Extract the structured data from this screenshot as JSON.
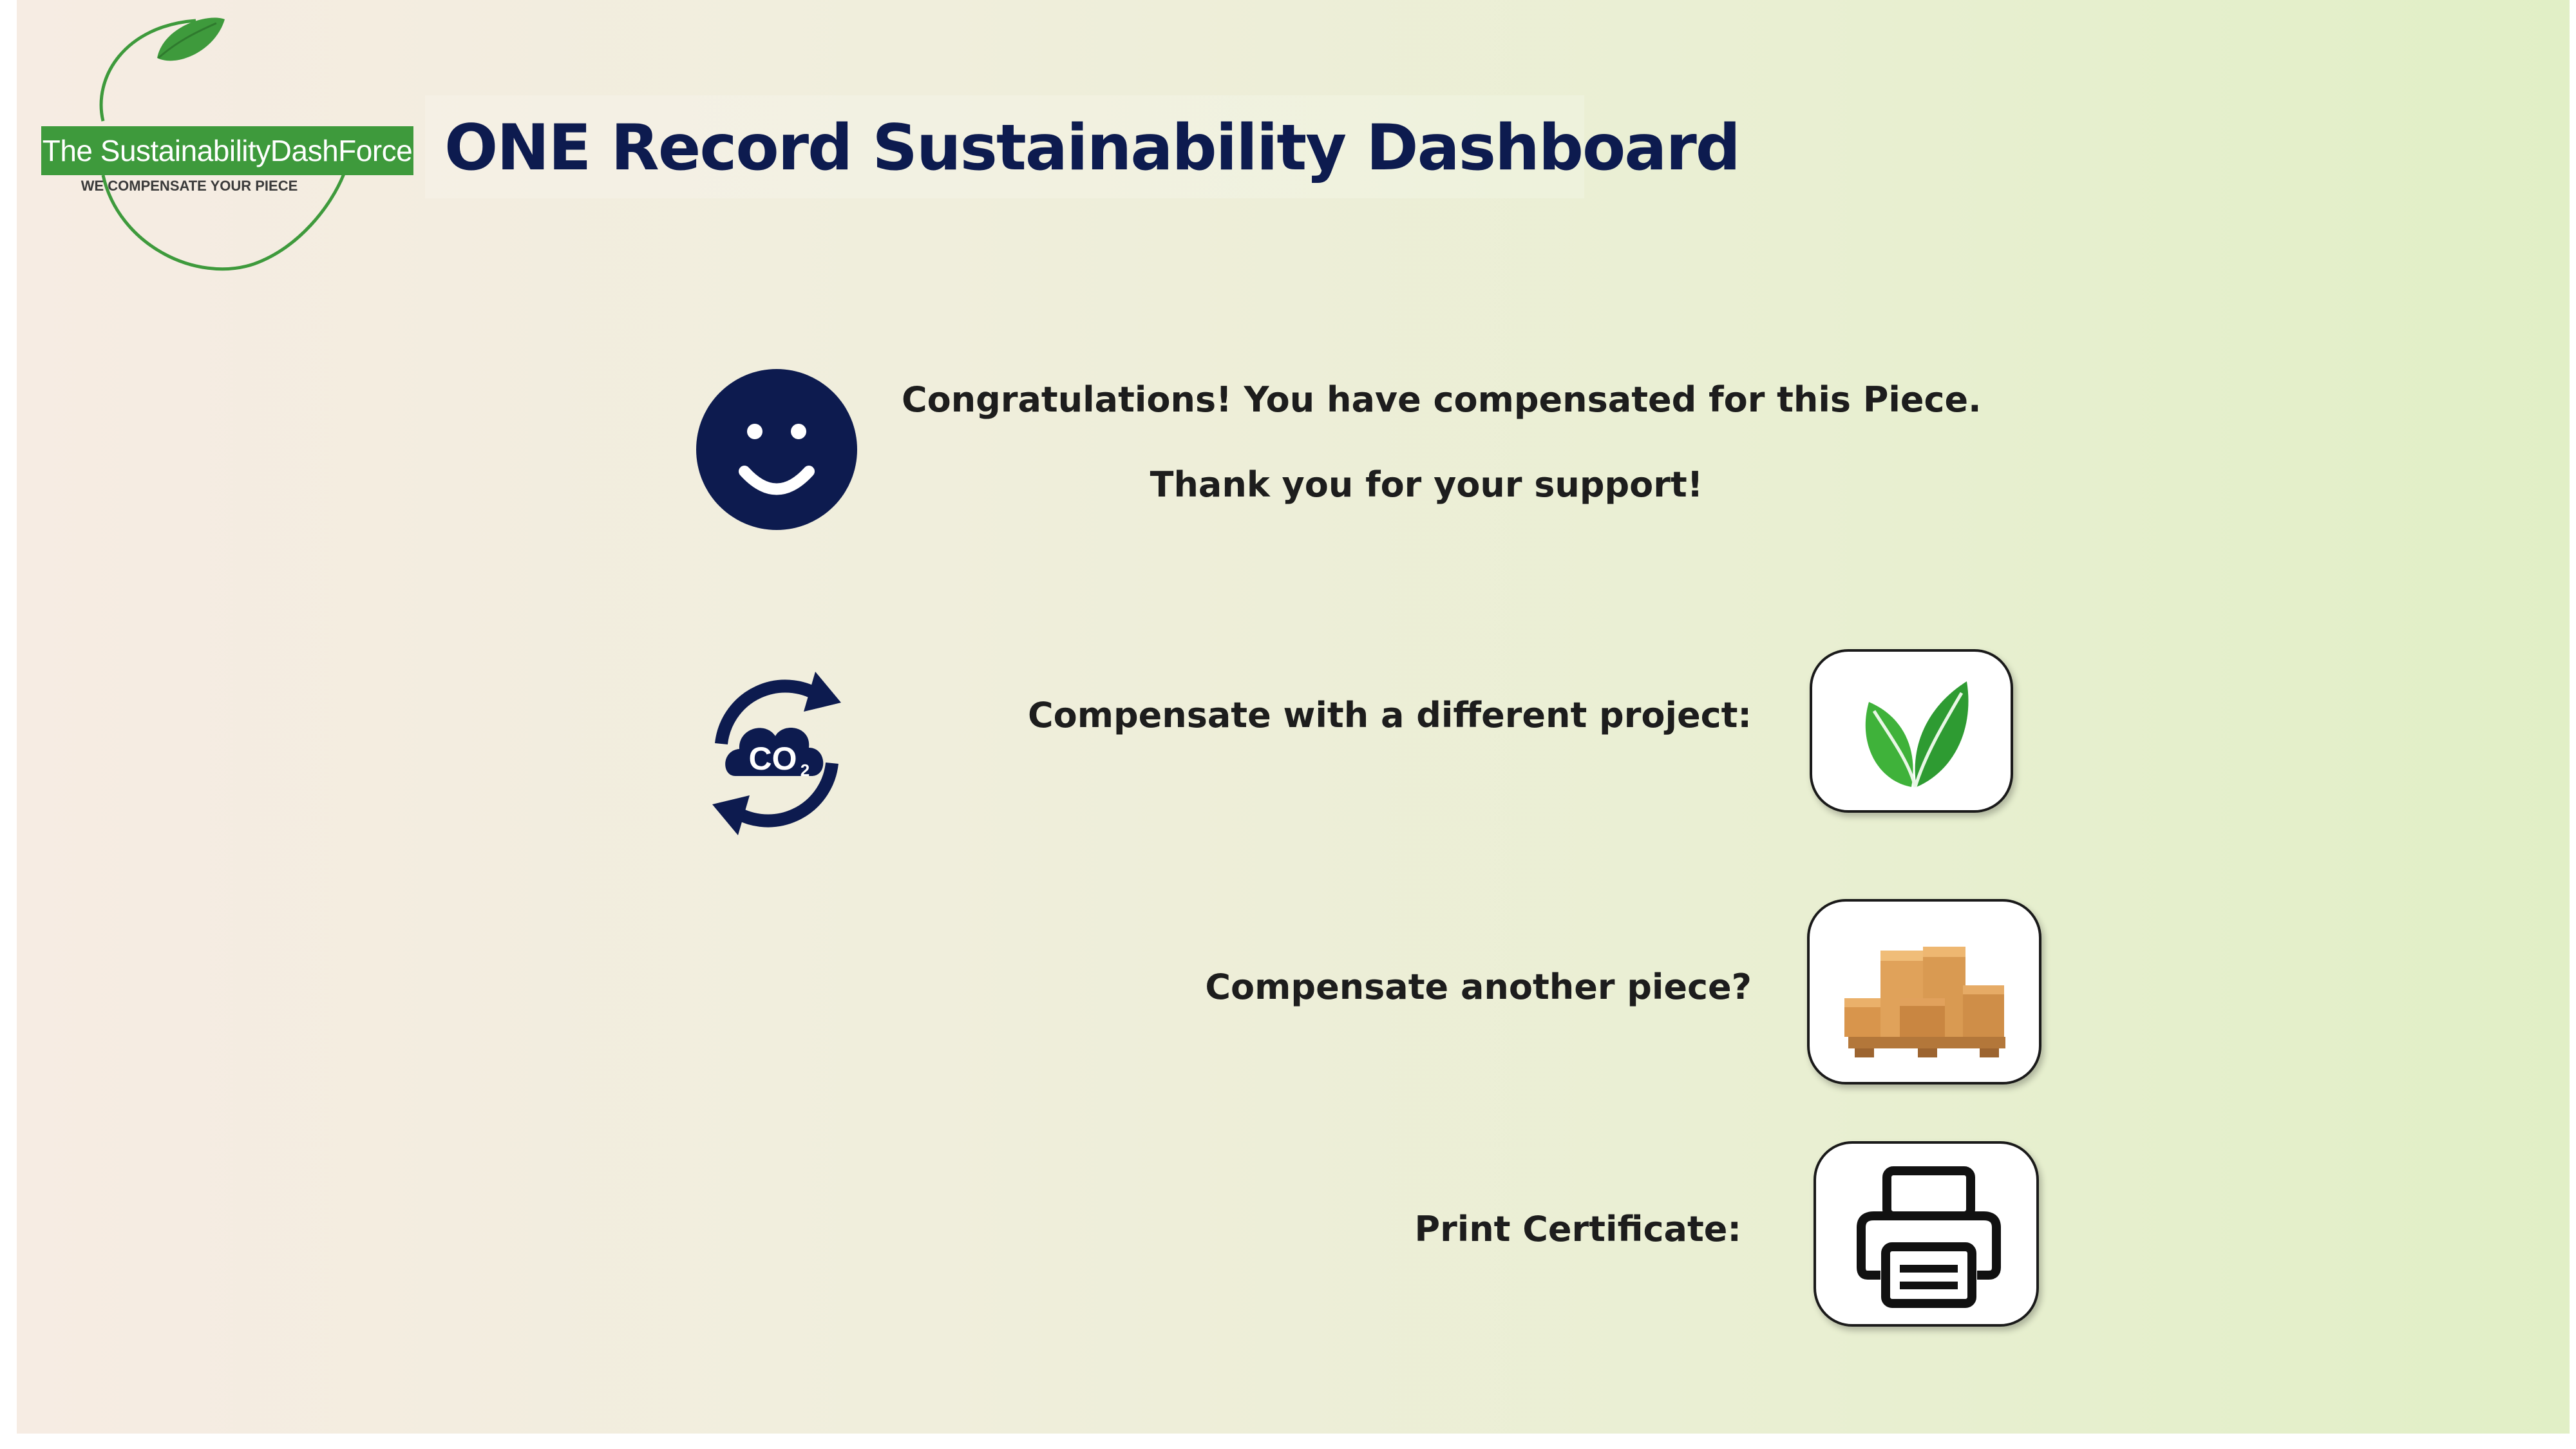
{
  "logo": {
    "brand_name": "The SustainabilityDashForce",
    "tagline": "WE COMPENSATE YOUR PIECE",
    "brand_color": "#3e9a3c"
  },
  "header": {
    "title": "ONE Record Sustainability Dashboard",
    "title_color": "#0d1b4f"
  },
  "status": {
    "icon": "smiley-icon",
    "congrats": "Congratulations! You have compensated for this Piece.",
    "thanks": "Thank you for your support!"
  },
  "actions": [
    {
      "label": "Compensate with a different project:",
      "icon": "leaf-icon"
    },
    {
      "label": "Compensate another piece?",
      "icon": "boxes-icon"
    },
    {
      "label": "Print Certificate:",
      "icon": "printer-icon"
    }
  ],
  "co2_icon": {
    "icon": "co2-cycle-icon",
    "text": "CO2"
  },
  "colors": {
    "navy": "#0d1b4f",
    "leaf_green": "#3e9a3c",
    "text": "#1d1d1d"
  }
}
